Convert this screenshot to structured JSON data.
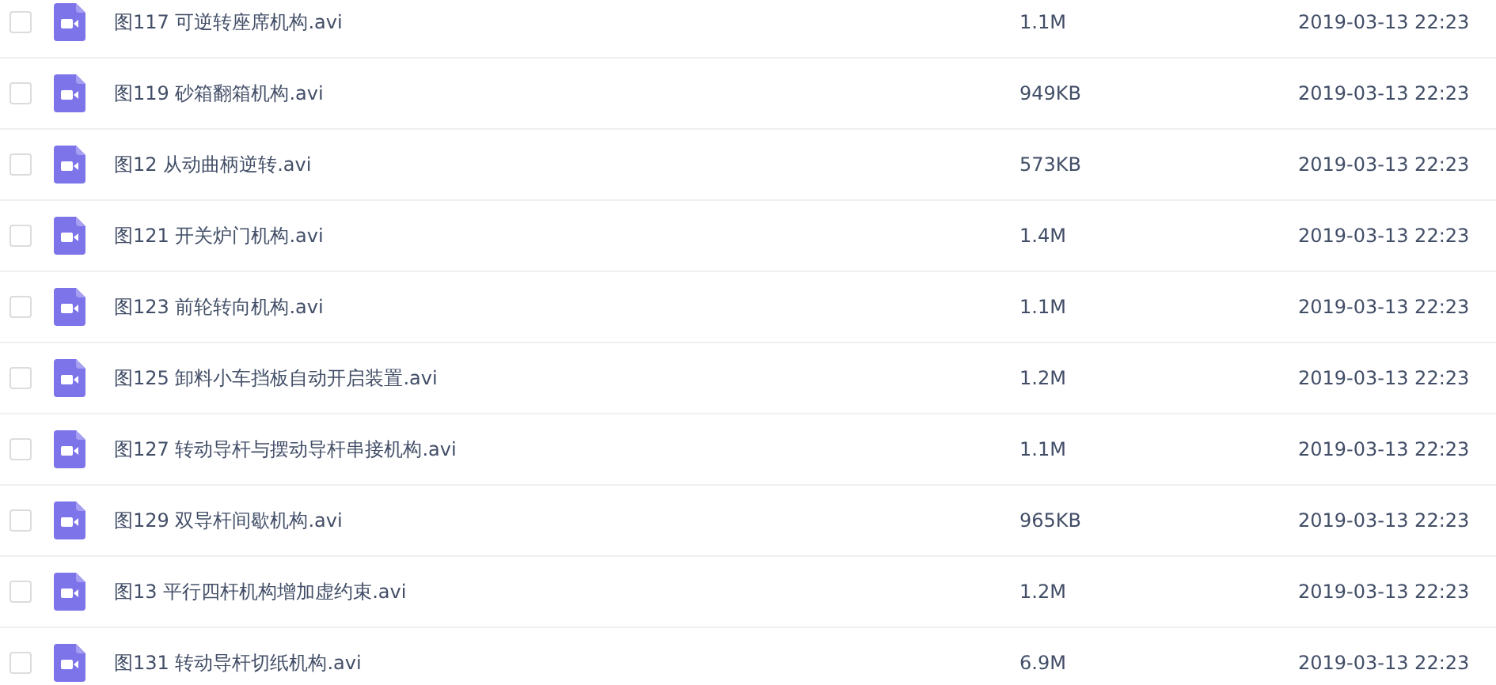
{
  "files": [
    {
      "name": "图117 可逆转座席机构.avi",
      "size": "1.1M",
      "modified": "2019-03-13 22:23",
      "checked": false
    },
    {
      "name": "图119 砂箱翻箱机构.avi",
      "size": "949KB",
      "modified": "2019-03-13 22:23",
      "checked": false
    },
    {
      "name": "图12 从动曲柄逆转.avi",
      "size": "573KB",
      "modified": "2019-03-13 22:23",
      "checked": false
    },
    {
      "name": "图121 开关炉门机构.avi",
      "size": "1.4M",
      "modified": "2019-03-13 22:23",
      "checked": false
    },
    {
      "name": "图123 前轮转向机构.avi",
      "size": "1.1M",
      "modified": "2019-03-13 22:23",
      "checked": false
    },
    {
      "name": "图125 卸料小车挡板自动开启装置.avi",
      "size": "1.2M",
      "modified": "2019-03-13 22:23",
      "checked": false
    },
    {
      "name": "图127 转动导杆与摆动导杆串接机构.avi",
      "size": "1.1M",
      "modified": "2019-03-13 22:23",
      "checked": false
    },
    {
      "name": "图129 双导杆间歇机构.avi",
      "size": "965KB",
      "modified": "2019-03-13 22:23",
      "checked": false
    },
    {
      "name": "图13 平行四杆机构增加虚约束.avi",
      "size": "1.2M",
      "modified": "2019-03-13 22:23",
      "checked": false
    },
    {
      "name": "图131 转动导杆切纸机构.avi",
      "size": "6.9M",
      "modified": "2019-03-13 22:23",
      "checked": false
    }
  ]
}
